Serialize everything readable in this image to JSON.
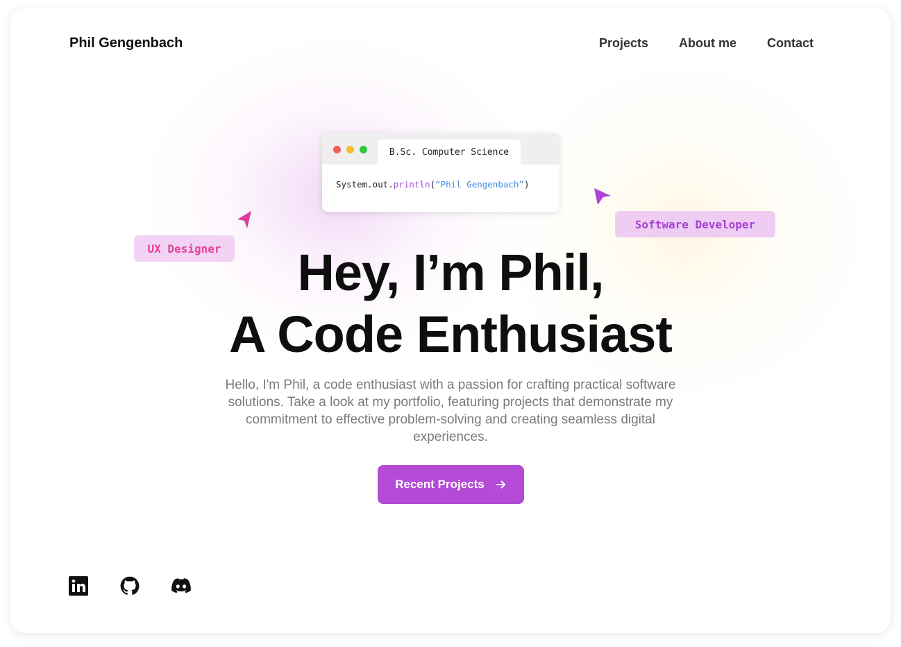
{
  "header": {
    "brand": "Phil Gengenbach",
    "nav": [
      {
        "label": "Projects"
      },
      {
        "label": "About me"
      },
      {
        "label": "Contact"
      }
    ]
  },
  "code_window": {
    "tab_label": "B.Sc. Computer Science",
    "code": {
      "object": "System.out.",
      "method": "println",
      "open": "(",
      "string": "“Phil Gengenbach”",
      "close": ")"
    },
    "window_dots": [
      "#f25f58",
      "#f8bb2d",
      "#2fc840"
    ]
  },
  "tags": {
    "ux": "UX Designer",
    "dev": "Software Developer"
  },
  "hero": {
    "line1": "Hey, I’m Phil,",
    "line2": "A Code Enthusiast",
    "intro": "Hello, I'm Phil, a code enthusiast with a passion for crafting practical software solutions. Take a look at my portfolio, featuring projects that demonstrate my commitment to effective problem-solving and creating seamless digital experiences.",
    "cta_label": "Recent Projects",
    "cta_icon": "arrow-right-icon"
  },
  "social": [
    {
      "icon": "linkedin-icon"
    },
    {
      "icon": "github-icon"
    },
    {
      "icon": "discord-icon"
    }
  ],
  "colors": {
    "accent": "#b44bd6",
    "ux_tag_text": "#e0459d",
    "dev_tag_text": "#a640d4"
  }
}
